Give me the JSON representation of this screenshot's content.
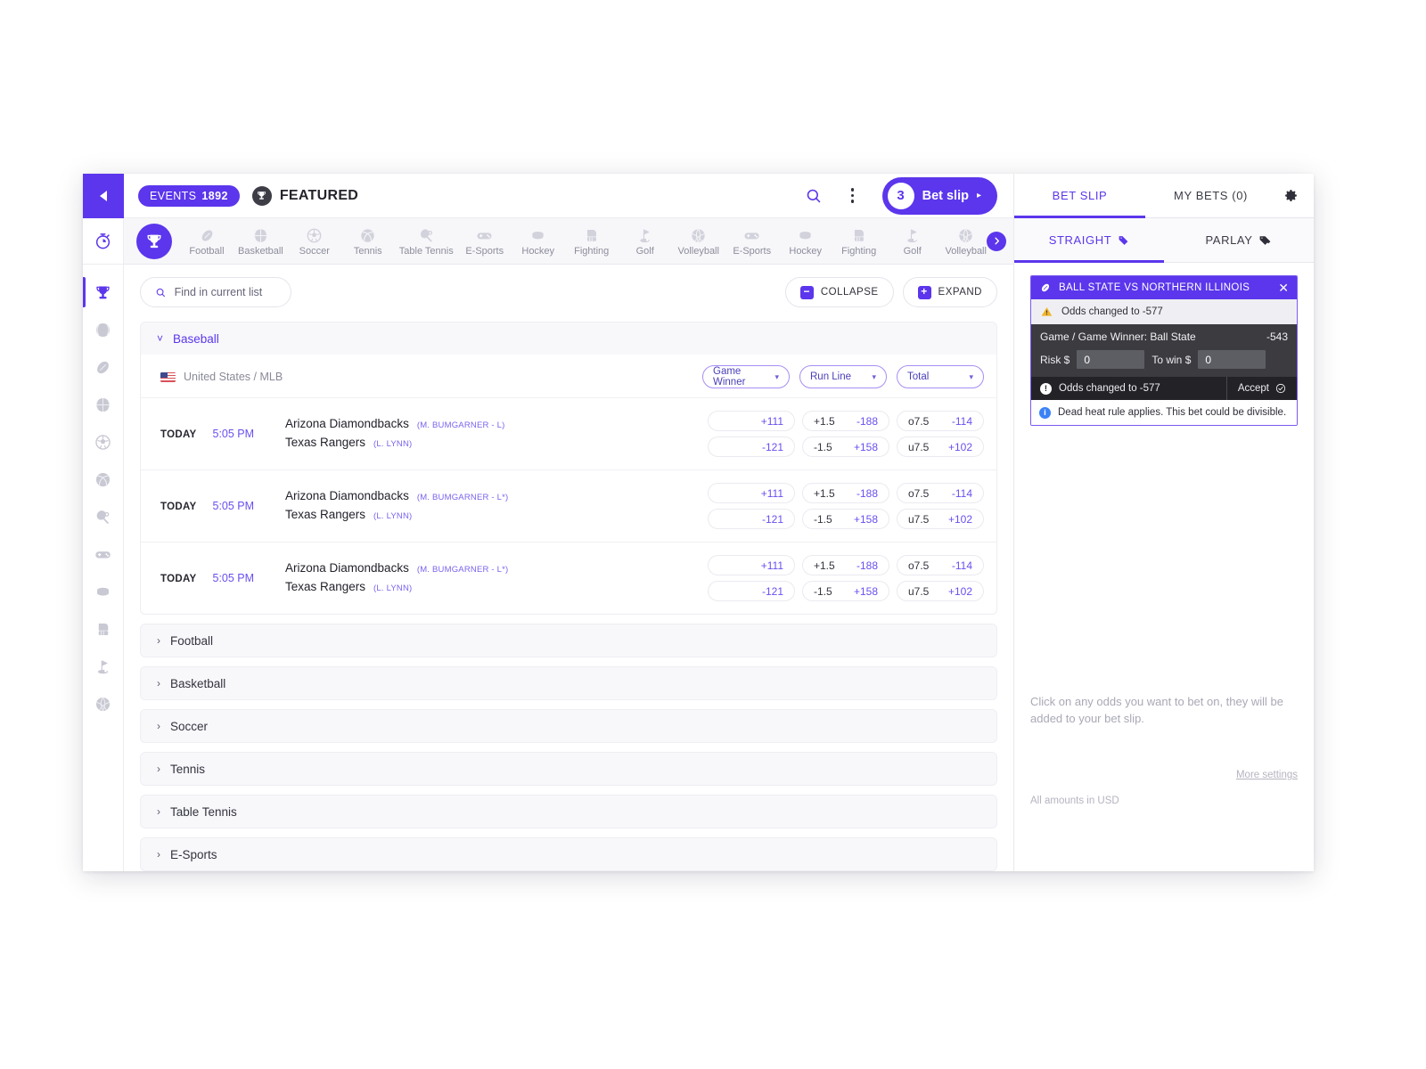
{
  "topbar": {
    "events_label": "EVENTS",
    "events_count": "1892",
    "featured_label": "FEATURED",
    "search_icon": "search-icon",
    "kebab_icon": "more-vertical-icon",
    "betslip_count": "3",
    "betslip_label": "Bet slip",
    "betslip_arrow": "▸"
  },
  "rail": {
    "collapse_icon": "collapse-left-icon",
    "items": [
      {
        "icon": "stopwatch-icon",
        "name": "live"
      },
      {
        "icon": "trophy-icon",
        "name": "featured"
      },
      {
        "icon": "baseball-icon",
        "name": "baseball"
      },
      {
        "icon": "football-icon",
        "name": "football"
      },
      {
        "icon": "basketball-icon",
        "name": "basketball"
      },
      {
        "icon": "soccer-icon",
        "name": "soccer"
      },
      {
        "icon": "tennis-icon",
        "name": "tennis"
      },
      {
        "icon": "table-tennis-icon",
        "name": "table-tennis"
      },
      {
        "icon": "gamepad-icon",
        "name": "e-sports"
      },
      {
        "icon": "hockey-puck-icon",
        "name": "hockey"
      },
      {
        "icon": "boxing-glove-icon",
        "name": "fighting"
      },
      {
        "icon": "golf-icon",
        "name": "golf"
      },
      {
        "icon": "volleyball-icon",
        "name": "volleyball"
      }
    ]
  },
  "sportsnav": {
    "first_icon": "trophy-icon",
    "next_icon": "chevron-right-icon",
    "items": [
      {
        "label": "Football",
        "icon": "football-icon"
      },
      {
        "label": "Basketball",
        "icon": "basketball-icon"
      },
      {
        "label": "Soccer",
        "icon": "soccer-icon"
      },
      {
        "label": "Tennis",
        "icon": "tennis-icon"
      },
      {
        "label": "Table Tennis",
        "icon": "table-tennis-icon"
      },
      {
        "label": "E-Sports",
        "icon": "gamepad-icon"
      },
      {
        "label": "Hockey",
        "icon": "hockey-puck-icon"
      },
      {
        "label": "Fighting",
        "icon": "boxing-glove-icon"
      },
      {
        "label": "Golf",
        "icon": "golf-icon"
      },
      {
        "label": "Volleyball",
        "icon": "volleyball-icon"
      },
      {
        "label": "E-Sports",
        "icon": "gamepad-icon"
      },
      {
        "label": "Hockey",
        "icon": "hockey-puck-icon"
      },
      {
        "label": "Fighting",
        "icon": "boxing-glove-icon"
      },
      {
        "label": "Golf",
        "icon": "golf-icon"
      },
      {
        "label": "Volleyball",
        "icon": "volleyball-icon"
      }
    ]
  },
  "toolbar": {
    "search_placeholder": "Find in current list",
    "search_value": "",
    "search_icon": "search-icon",
    "collapse_label": "COLLAPSE",
    "collapse_icon": "minus-square-icon",
    "expand_label": "EXPAND",
    "expand_icon": "plus-square-icon"
  },
  "baseball": {
    "title": "Baseball",
    "chevron": "˅",
    "league": "United States / MLB",
    "flag_icon": "us-flag-icon",
    "markets": [
      {
        "label": "Game Winner"
      },
      {
        "label": "Run Line"
      },
      {
        "label": "Total"
      }
    ],
    "games": [
      {
        "day": "TODAY",
        "time": "5:05 PM",
        "team_away": "Arizona Diamondbacks",
        "pitcher_away": "(M. BUMGARNER - L)",
        "team_home": "Texas Rangers",
        "pitcher_home": "(L. LYNN)",
        "moneyline": [
          "+111",
          "-121"
        ],
        "runline_hcap": [
          "+1.5",
          "-1.5"
        ],
        "runline_price": [
          "-188",
          "+158"
        ],
        "total_hcap": [
          "o7.5",
          "u7.5"
        ],
        "total_price": [
          "-114",
          "+102"
        ]
      },
      {
        "day": "TODAY",
        "time": "5:05 PM",
        "team_away": "Arizona Diamondbacks",
        "pitcher_away": "(M. BUMGARNER - L*)",
        "team_home": "Texas Rangers",
        "pitcher_home": "(L. LYNN)",
        "moneyline": [
          "+111",
          "-121"
        ],
        "runline_hcap": [
          "+1.5",
          "-1.5"
        ],
        "runline_price": [
          "-188",
          "+158"
        ],
        "total_hcap": [
          "o7.5",
          "u7.5"
        ],
        "total_price": [
          "-114",
          "+102"
        ]
      },
      {
        "day": "TODAY",
        "time": "5:05 PM",
        "team_away": "Arizona Diamondbacks",
        "pitcher_away": "(M. BUMGARNER - L*)",
        "team_home": "Texas Rangers",
        "pitcher_home": "(L. LYNN)",
        "moneyline": [
          "+111",
          "-121"
        ],
        "runline_hcap": [
          "+1.5",
          "-1.5"
        ],
        "runline_price": [
          "-188",
          "+158"
        ],
        "total_hcap": [
          "o7.5",
          "u7.5"
        ],
        "total_price": [
          "-114",
          "+102"
        ]
      }
    ]
  },
  "collapsed_sections": [
    {
      "label": "Football"
    },
    {
      "label": "Basketball"
    },
    {
      "label": "Soccer"
    },
    {
      "label": "Tennis"
    },
    {
      "label": "Table Tennis"
    },
    {
      "label": "E-Sports"
    }
  ],
  "panel": {
    "tab_betslip": "BET SLIP",
    "tab_mybets": "MY BETS (0)",
    "gear_icon": "gear-icon",
    "tab_straight": "STRAIGHT",
    "tab_parlay": "PARLAY",
    "tag_icon": "tag-icon",
    "bet": {
      "title": "BALL STATE VS NORTHERN ILLINOIS",
      "sport_icon": "football-icon",
      "close_icon": "close-icon",
      "warning_icon": "warning-triangle-icon",
      "warning_text": "Odds changed to -577",
      "market": "Game / Game Winner: Ball State",
      "price": "-543",
      "risk_label": "Risk $",
      "risk_value": "0",
      "towin_label": "To win $",
      "towin_value": "0",
      "accept_msg": "Odds changed to -577",
      "accept_label": "Accept",
      "accept_icon": "check-circle-icon",
      "note_icon": "info-icon",
      "note_text": "Dead heat rule applies. This bet could be divisible."
    },
    "hint": "Click on any odds you want to bet on, they will be added to your bet slip.",
    "more_settings": "More settings",
    "usd_note": "All amounts in USD"
  },
  "colors": {
    "accent": "#5b36ec",
    "accent_text": "#6a4ff0",
    "dark_card": "#3b3b40",
    "warn": "#f0b429"
  }
}
